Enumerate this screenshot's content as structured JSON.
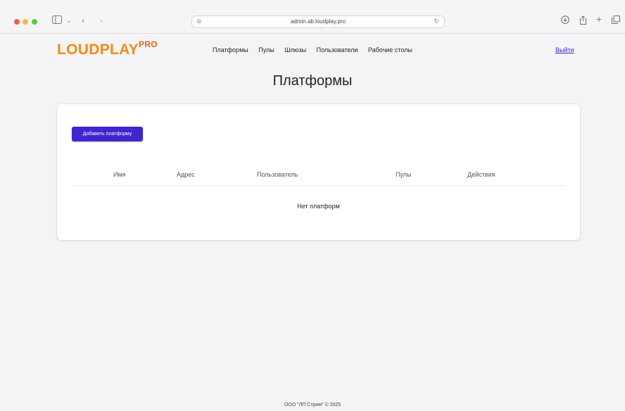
{
  "browser": {
    "url": "admin.ab.loudplay.pro"
  },
  "header": {
    "logo_main": "LOUDPLAY",
    "logo_sup": "PRO",
    "nav": [
      "Платформы",
      "Пулы",
      "Шлюзы",
      "Пользователи",
      "Рабочие столы"
    ],
    "logout": "Выйти"
  },
  "page": {
    "title": "Платформы",
    "add_button": "Добавить платформу",
    "table": {
      "columns": [
        "Имя",
        "Адрес",
        "Пользователь",
        "Пулы",
        "Действия"
      ],
      "empty_message": "Нет платформ"
    }
  },
  "footer": {
    "text": "ООО \"ЛП Стрим\" © 2025"
  },
  "colors": {
    "logo": "#f28b10",
    "primary_button": "#3f26cf",
    "link": "#3b2bd1"
  }
}
